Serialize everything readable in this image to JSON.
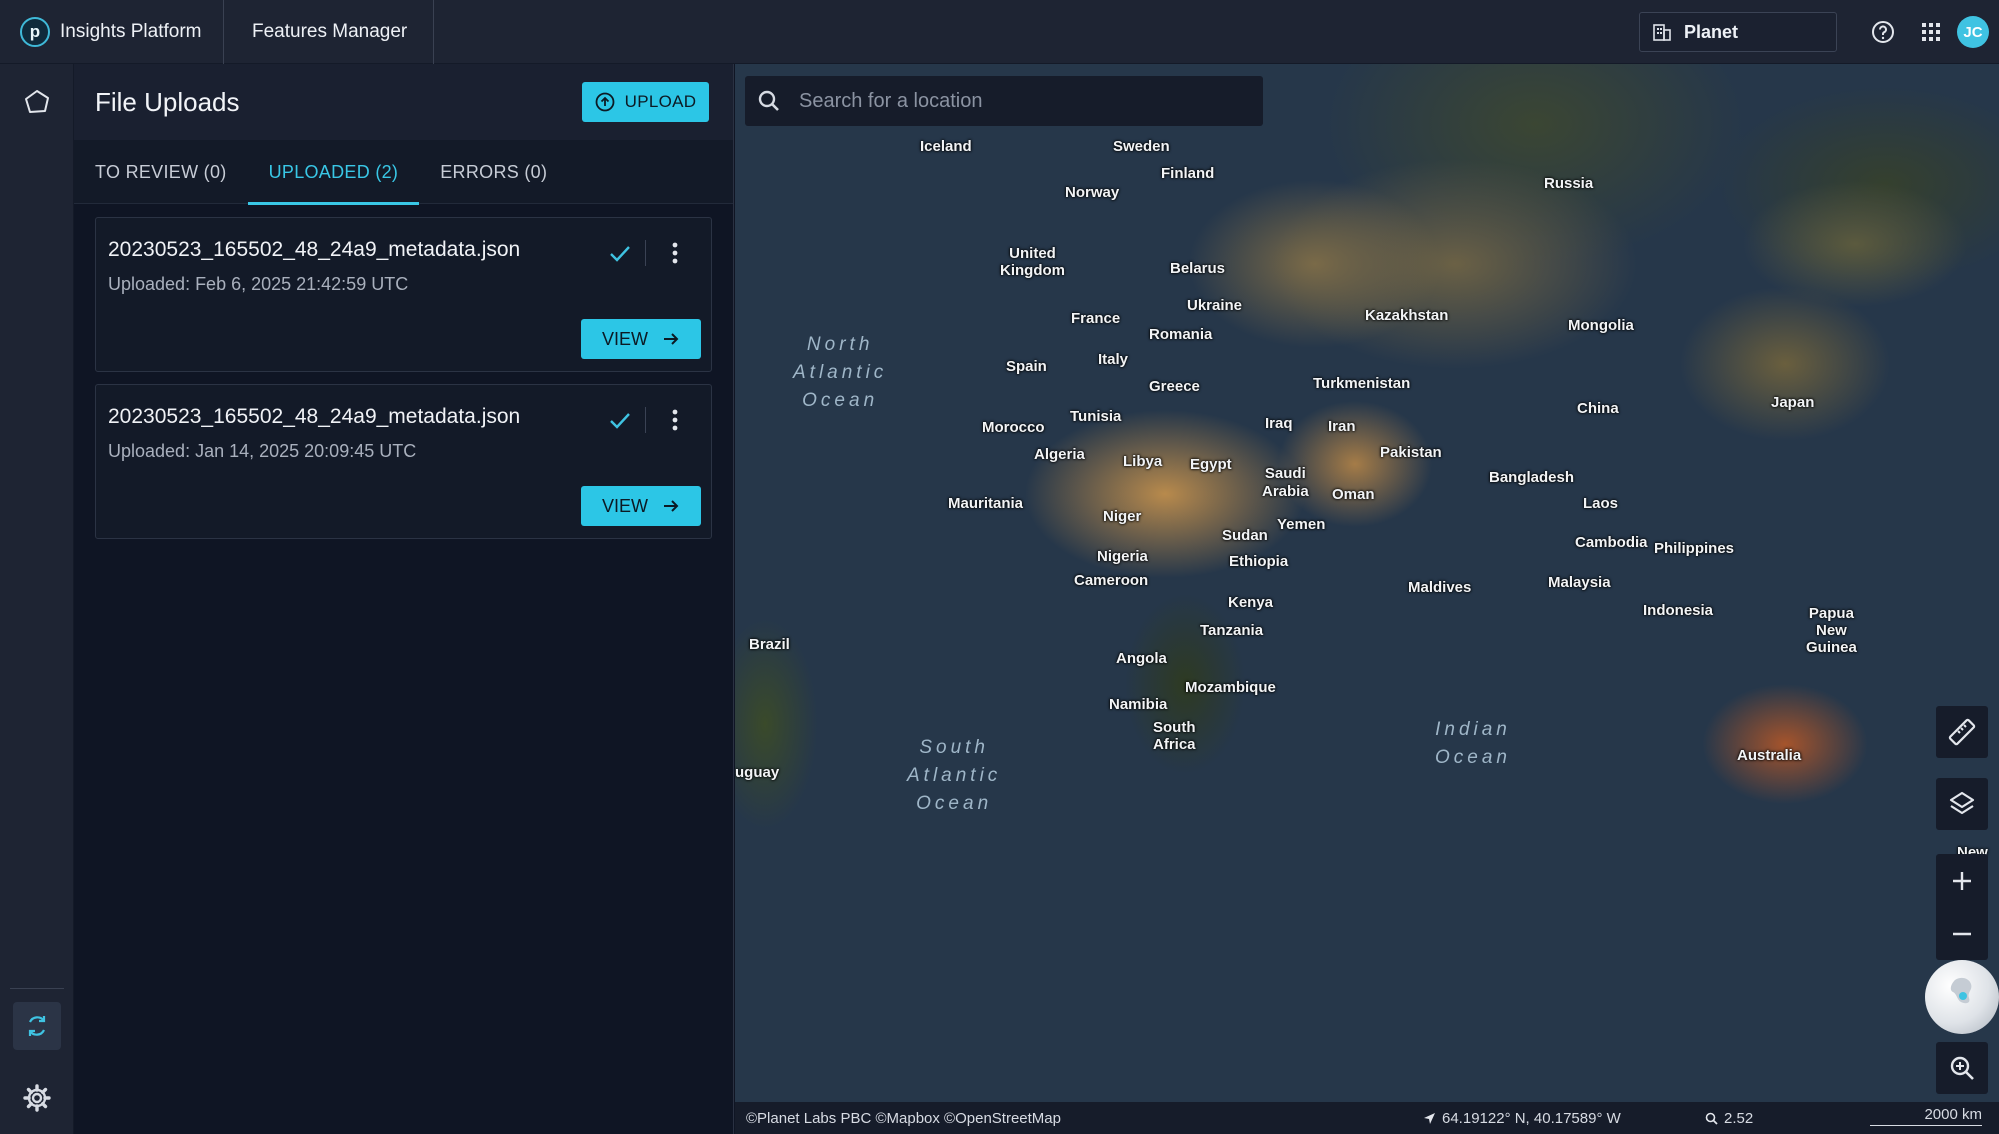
{
  "topbar": {
    "logo_letter": "p",
    "brand": "Insights Platform",
    "breadcrumb": "Features Manager",
    "org": "Planet",
    "avatar_initials": "JC"
  },
  "panel": {
    "title": "File Uploads",
    "upload_label": "UPLOAD",
    "tabs": [
      {
        "label": "TO REVIEW (0)",
        "active": false
      },
      {
        "label": "UPLOADED (2)",
        "active": true
      },
      {
        "label": "ERRORS (0)",
        "active": false
      }
    ],
    "cards": [
      {
        "filename": "20230523_165502_48_24a9_metadata.json",
        "uploaded": "Uploaded: Feb 6, 2025 21:42:59 UTC",
        "view_label": "VIEW"
      },
      {
        "filename": "20230523_165502_48_24a9_metadata.json",
        "uploaded": "Uploaded: Jan 14, 2025 20:09:45 UTC",
        "view_label": "VIEW"
      }
    ]
  },
  "map": {
    "search_placeholder": "Search for a location",
    "labels": {
      "iceland": "Iceland",
      "sweden": "Sweden",
      "finland": "Finland",
      "norway": "Norway",
      "russia": "Russia",
      "uk": "United\nKingdom",
      "belarus": "Belarus",
      "ukraine": "Ukraine",
      "kazakhstan": "Kazakhstan",
      "mongolia": "Mongolia",
      "france": "France",
      "romania": "Romania",
      "spain": "Spain",
      "italy": "Italy",
      "greece": "Greece",
      "turkmenistan": "Turkmenistan",
      "japan": "Japan",
      "china": "China",
      "tunisia": "Tunisia",
      "morocco": "Morocco",
      "iraq": "Iraq",
      "iran": "Iran",
      "algeria": "Algeria",
      "libya": "Libya",
      "egypt": "Egypt",
      "pakistan": "Pakistan",
      "saudi": "Saudi\nArabia",
      "oman": "Oman",
      "bangladesh": "Bangladesh",
      "mauritania": "Mauritania",
      "laos": "Laos",
      "niger": "Niger",
      "sudan": "Sudan",
      "yemen": "Yemen",
      "cambodia": "Cambodia",
      "philippines": "Philippines",
      "nigeria": "Nigeria",
      "ethiopia": "Ethiopia",
      "cameroon": "Cameroon",
      "malaysia": "Malaysia",
      "maldives": "Maldives",
      "kenya": "Kenya",
      "indonesia": "Indonesia",
      "png": "Papua\nNew\nGuinea",
      "tanzania": "Tanzania",
      "brazil": "Brazil",
      "angola": "Angola",
      "mozambique": "Mozambique",
      "namibia": "Namibia",
      "south_africa": "South\nAfrica",
      "australia": "Australia",
      "uruguay": "uguay",
      "new_zealand": "New"
    },
    "oceans": {
      "north_atlantic": "North\nAtlantic\nOcean",
      "south_atlantic": "South\nAtlantic\nOcean",
      "indian": "Indian\nOcean"
    },
    "attribution": "©Planet Labs PBC ©Mapbox ©OpenStreetMap",
    "coordinates": "64.19122° N, 40.17589° W",
    "zoom_level": "2.52",
    "scale": "2000 km"
  }
}
